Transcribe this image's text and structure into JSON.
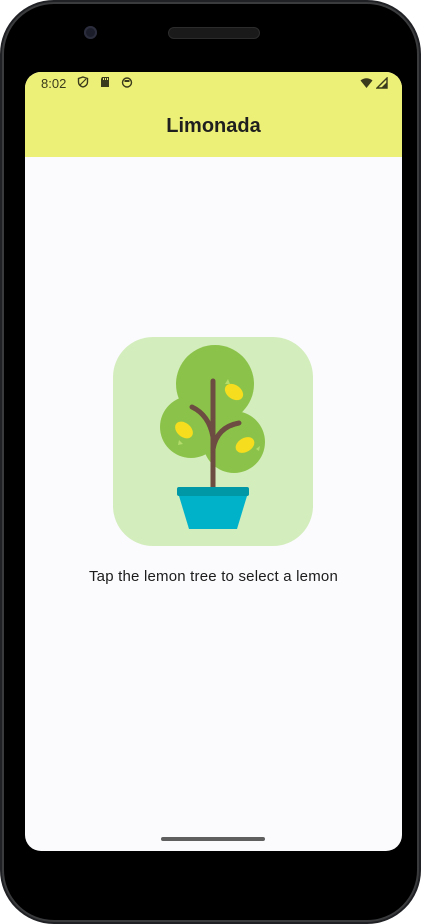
{
  "status_bar": {
    "time": "8:02",
    "left_icons": [
      "shield-icon",
      "sd-card-icon",
      "notification-icon"
    ],
    "right_icons": [
      "wifi-icon",
      "signal-icon"
    ]
  },
  "app_bar": {
    "title": "Limonada"
  },
  "main": {
    "image_name": "lemon-tree",
    "instruction": "Tap the lemon tree to select a lemon"
  },
  "colors": {
    "app_bar_background": "#edf076",
    "screen_background": "#fbfbfe",
    "image_tile_background": "#d4edbd",
    "pot": "#00b2c9",
    "foliage": "#8bc34a",
    "lemon": "#f6dd1e",
    "trunk": "#6d4c41"
  }
}
